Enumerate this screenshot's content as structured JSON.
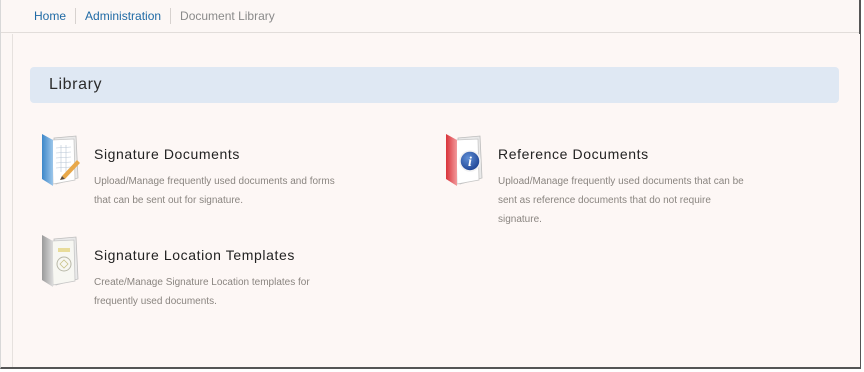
{
  "breadcrumb": {
    "items": [
      {
        "label": "Home"
      },
      {
        "label": "Administration"
      },
      {
        "label": "Document Library"
      }
    ]
  },
  "section": {
    "title": "Library"
  },
  "items": [
    {
      "title": "Signature Documents",
      "description": "Upload/Manage frequently used documents and forms that can be sent out for signature.",
      "icon": "blue-folder-signature-icon"
    },
    {
      "title": "Reference Documents",
      "description": "Upload/Manage frequently used documents that can be sent as reference documents that do not require signature.",
      "icon": "red-folder-info-icon"
    },
    {
      "title": "Signature Location Templates",
      "description": "Create/Manage Signature Location templates for frequently used documents.",
      "icon": "grey-folder-template-icon"
    }
  ],
  "colors": {
    "link": "#1f6aa5",
    "header_bg": "#dfe8f3",
    "page_bg": "#fcf7f5"
  }
}
